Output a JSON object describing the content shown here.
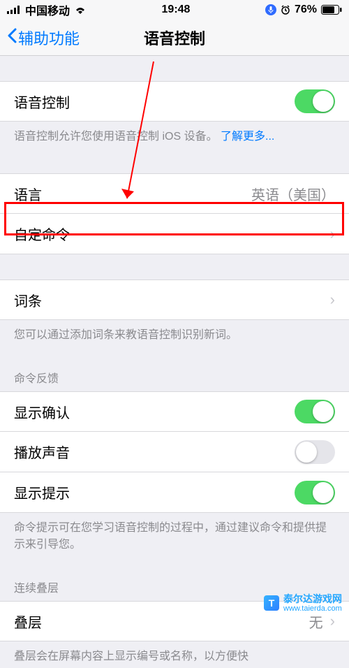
{
  "status": {
    "carrier": "中国移动",
    "time": "19:48",
    "battery": "76%"
  },
  "nav": {
    "back": "辅助功能",
    "title": "语音控制"
  },
  "voice_control": {
    "label": "语音控制",
    "footer": "语音控制允许您使用语音控制 iOS 设备。",
    "learn_more": "了解更多..."
  },
  "language": {
    "label": "语言",
    "value": "英语（美国）"
  },
  "custom_commands": {
    "label": "自定命令"
  },
  "vocabulary": {
    "label": "词条",
    "footer": "您可以通过添加词条来教语音控制识别新词。"
  },
  "command_feedback": {
    "header": "命令反馈",
    "show_confirmation": "显示确认",
    "play_sound": "播放声音",
    "show_hints": "显示提示",
    "footer": "命令提示可在您学习语音控制的过程中，通过建议命令和提供提示来引导您。"
  },
  "overlay": {
    "header": "连续叠层",
    "label": "叠层",
    "value": "无",
    "footer": "叠层会在屏幕内容上显示编号或名称，以方便快"
  },
  "watermark": {
    "brand": "泰尔达游戏网",
    "url": "www.taierda.com"
  }
}
